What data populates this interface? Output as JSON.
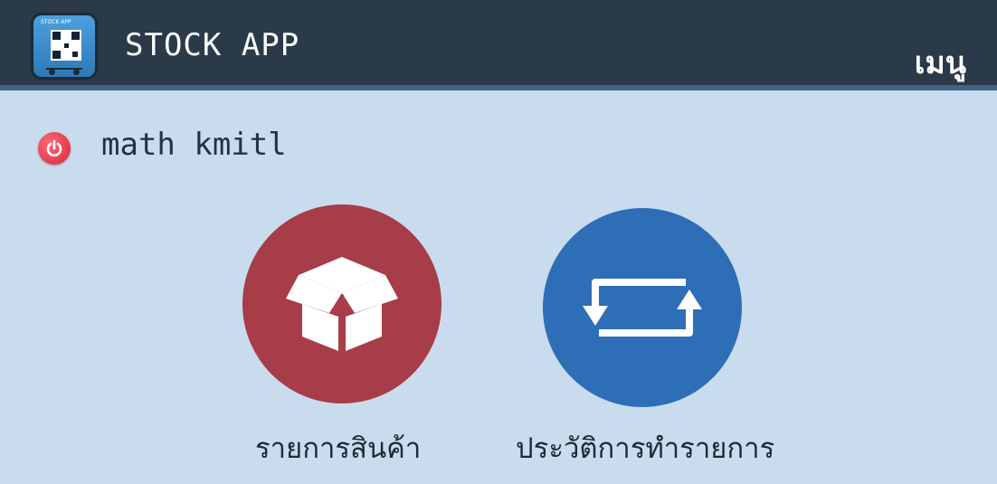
{
  "header": {
    "logo_label": "STOCK APP",
    "title": "STOCK APP",
    "menu_label": "เมนู"
  },
  "user": {
    "name": "math kmitl",
    "logout_icon": "power-icon"
  },
  "menu_tiles": [
    {
      "label": "รายการสินค้า",
      "icon": "box-icon",
      "color": "#a73d48"
    },
    {
      "label": "ประวัติการทำรายการ",
      "icon": "refresh-cycle-icon",
      "color": "#2d6eb7"
    }
  ],
  "colors": {
    "header_bg": "#2a3a48",
    "page_bg": "#c9dced",
    "power_button": "#d9253a"
  }
}
